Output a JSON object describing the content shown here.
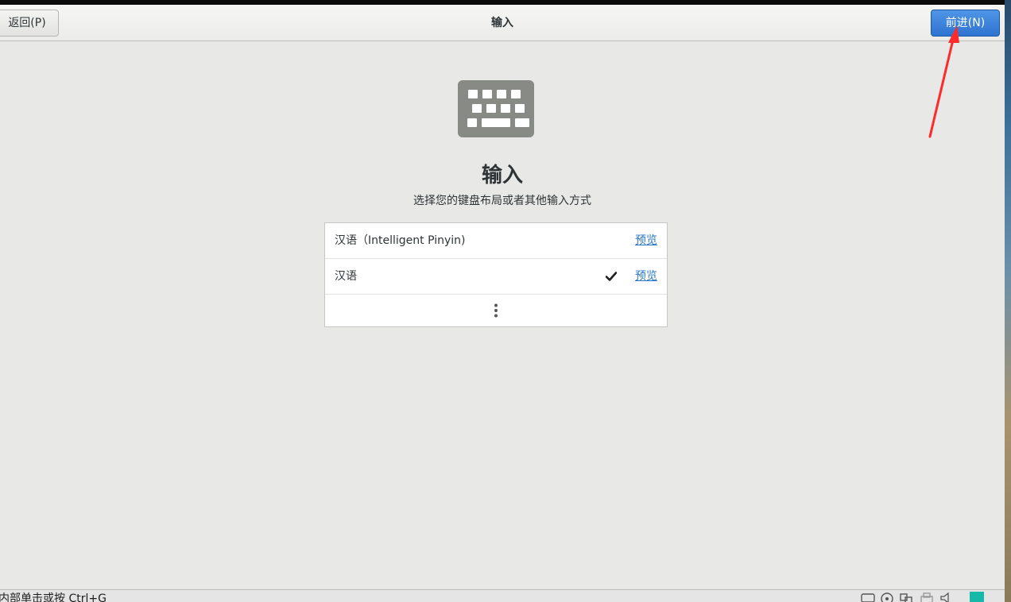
{
  "header": {
    "back_label": "返回(P)",
    "title": "输入",
    "next_label": "前进(N)"
  },
  "page": {
    "title": "输入",
    "subtitle": "选择您的键盘布局或者其他输入方式"
  },
  "input_sources": [
    {
      "label": "汉语（Intelligent Pinyin)",
      "preview_label": "预览",
      "selected": false
    },
    {
      "label": "汉语",
      "preview_label": "预览",
      "selected": true
    }
  ],
  "statusbar": {
    "hint": "内部单击或按 Ctrl+G"
  },
  "colors": {
    "accent": "#3584e4",
    "link": "#2a76c6",
    "annotation_arrow": "#ff2a2a"
  }
}
